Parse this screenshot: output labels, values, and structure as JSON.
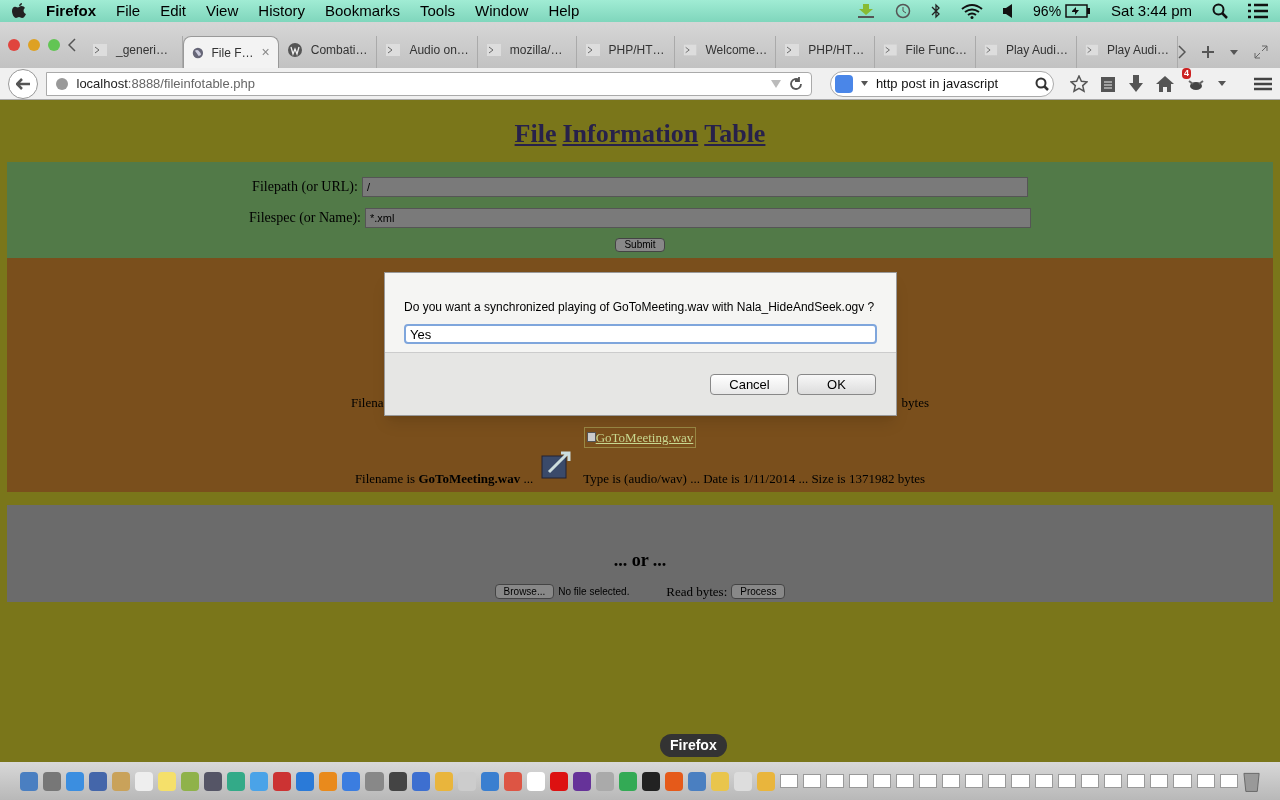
{
  "menubar": {
    "app": "Firefox",
    "items": [
      "File",
      "Edit",
      "View",
      "History",
      "Bookmarks",
      "Tools",
      "Window",
      "Help"
    ],
    "battery": "96%",
    "clock": "Sat 3:44 pm"
  },
  "tabs": [
    {
      "label": "_generi…",
      "kind": "page",
      "selected": false
    },
    {
      "label": "File F…",
      "kind": "globe",
      "selected": true
    },
    {
      "label": "Combati…",
      "kind": "wordpress",
      "selected": false
    },
    {
      "label": "Audio on…",
      "kind": "page",
      "selected": false
    },
    {
      "label": "mozilla/…",
      "kind": "page",
      "selected": false
    },
    {
      "label": "PHP/HT…",
      "kind": "page",
      "selected": false
    },
    {
      "label": "Welcome…",
      "kind": "page",
      "selected": false
    },
    {
      "label": "PHP/HT…",
      "kind": "page",
      "selected": false
    },
    {
      "label": "File Func…",
      "kind": "page",
      "selected": false
    },
    {
      "label": "Play Audi…",
      "kind": "page",
      "selected": false
    },
    {
      "label": "Play Audi…",
      "kind": "page",
      "selected": false
    }
  ],
  "close_tab": "×",
  "address": {
    "host": "localhost",
    "rest": ":8888/fileinfotable.php"
  },
  "search": {
    "value": "http post in javascript"
  },
  "addon_badge": "4",
  "page": {
    "heading": [
      "File",
      "Information",
      "Table"
    ],
    "form": [
      {
        "label": "Filepath (or URL):",
        "value": "/"
      },
      {
        "label": "Filespec (or Name):",
        "value": "*.xml"
      }
    ],
    "submit": "Submit",
    "partial_row": {
      "left": "Filena",
      "right": "bytes"
    },
    "link": "GoToMeeting.wav",
    "file_row": {
      "prefix": "Filename is",
      "name": "GoToMeeting.wav",
      "suffix": "...",
      "info": "Type is (audio/wav) ... Date is 1/11/2014 ... Size is 1371982 bytes"
    },
    "or": "... or ...",
    "browse": "Browse...",
    "no_file": "No file selected.",
    "read_bytes": "Read bytes:",
    "process": "Process"
  },
  "dialog": {
    "message": "Do you want a synchronized playing of GoToMeeting.wav with Nala_HideAndSeek.ogv ?",
    "value": "Yes",
    "cancel": "Cancel",
    "ok": "OK"
  },
  "dock": {
    "tooltip": "Firefox"
  }
}
